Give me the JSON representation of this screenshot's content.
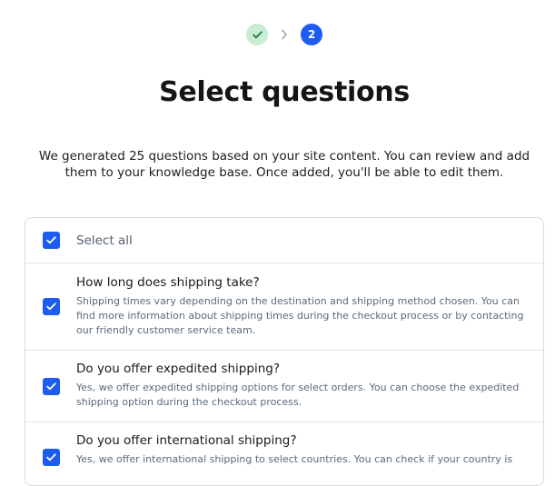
{
  "stepper": {
    "step1_state": "completed",
    "step2_label": "2"
  },
  "page": {
    "title": "Select questions",
    "intro": "We generated 25 questions based on your site content. You can review and add them to your knowledge base. Once added, you'll be able to edit them."
  },
  "list": {
    "select_all_label": "Select all",
    "select_all_checked": true,
    "questions": [
      {
        "title": "How long does shipping take?",
        "answer": "Shipping times vary depending on the destination and shipping method chosen. You can find more information about shipping times during the checkout process or by contacting our friendly customer service team.",
        "checked": true
      },
      {
        "title": "Do you offer expedited shipping?",
        "answer": "Yes, we offer expedited shipping options for select orders. You can choose the expedited shipping option during the checkout process.",
        "checked": true
      },
      {
        "title": "Do you offer international shipping?",
        "answer": "Yes, we offer international shipping to select countries. You can check if your country is",
        "checked": true
      }
    ]
  },
  "colors": {
    "accent": "#1d5cf0",
    "step_done_bg": "#c9ecd4",
    "check_green": "#1e7a3c"
  },
  "icons": {
    "step_done": "check-icon",
    "step_separator": "chevron-right-icon",
    "checkbox": "check-icon"
  }
}
